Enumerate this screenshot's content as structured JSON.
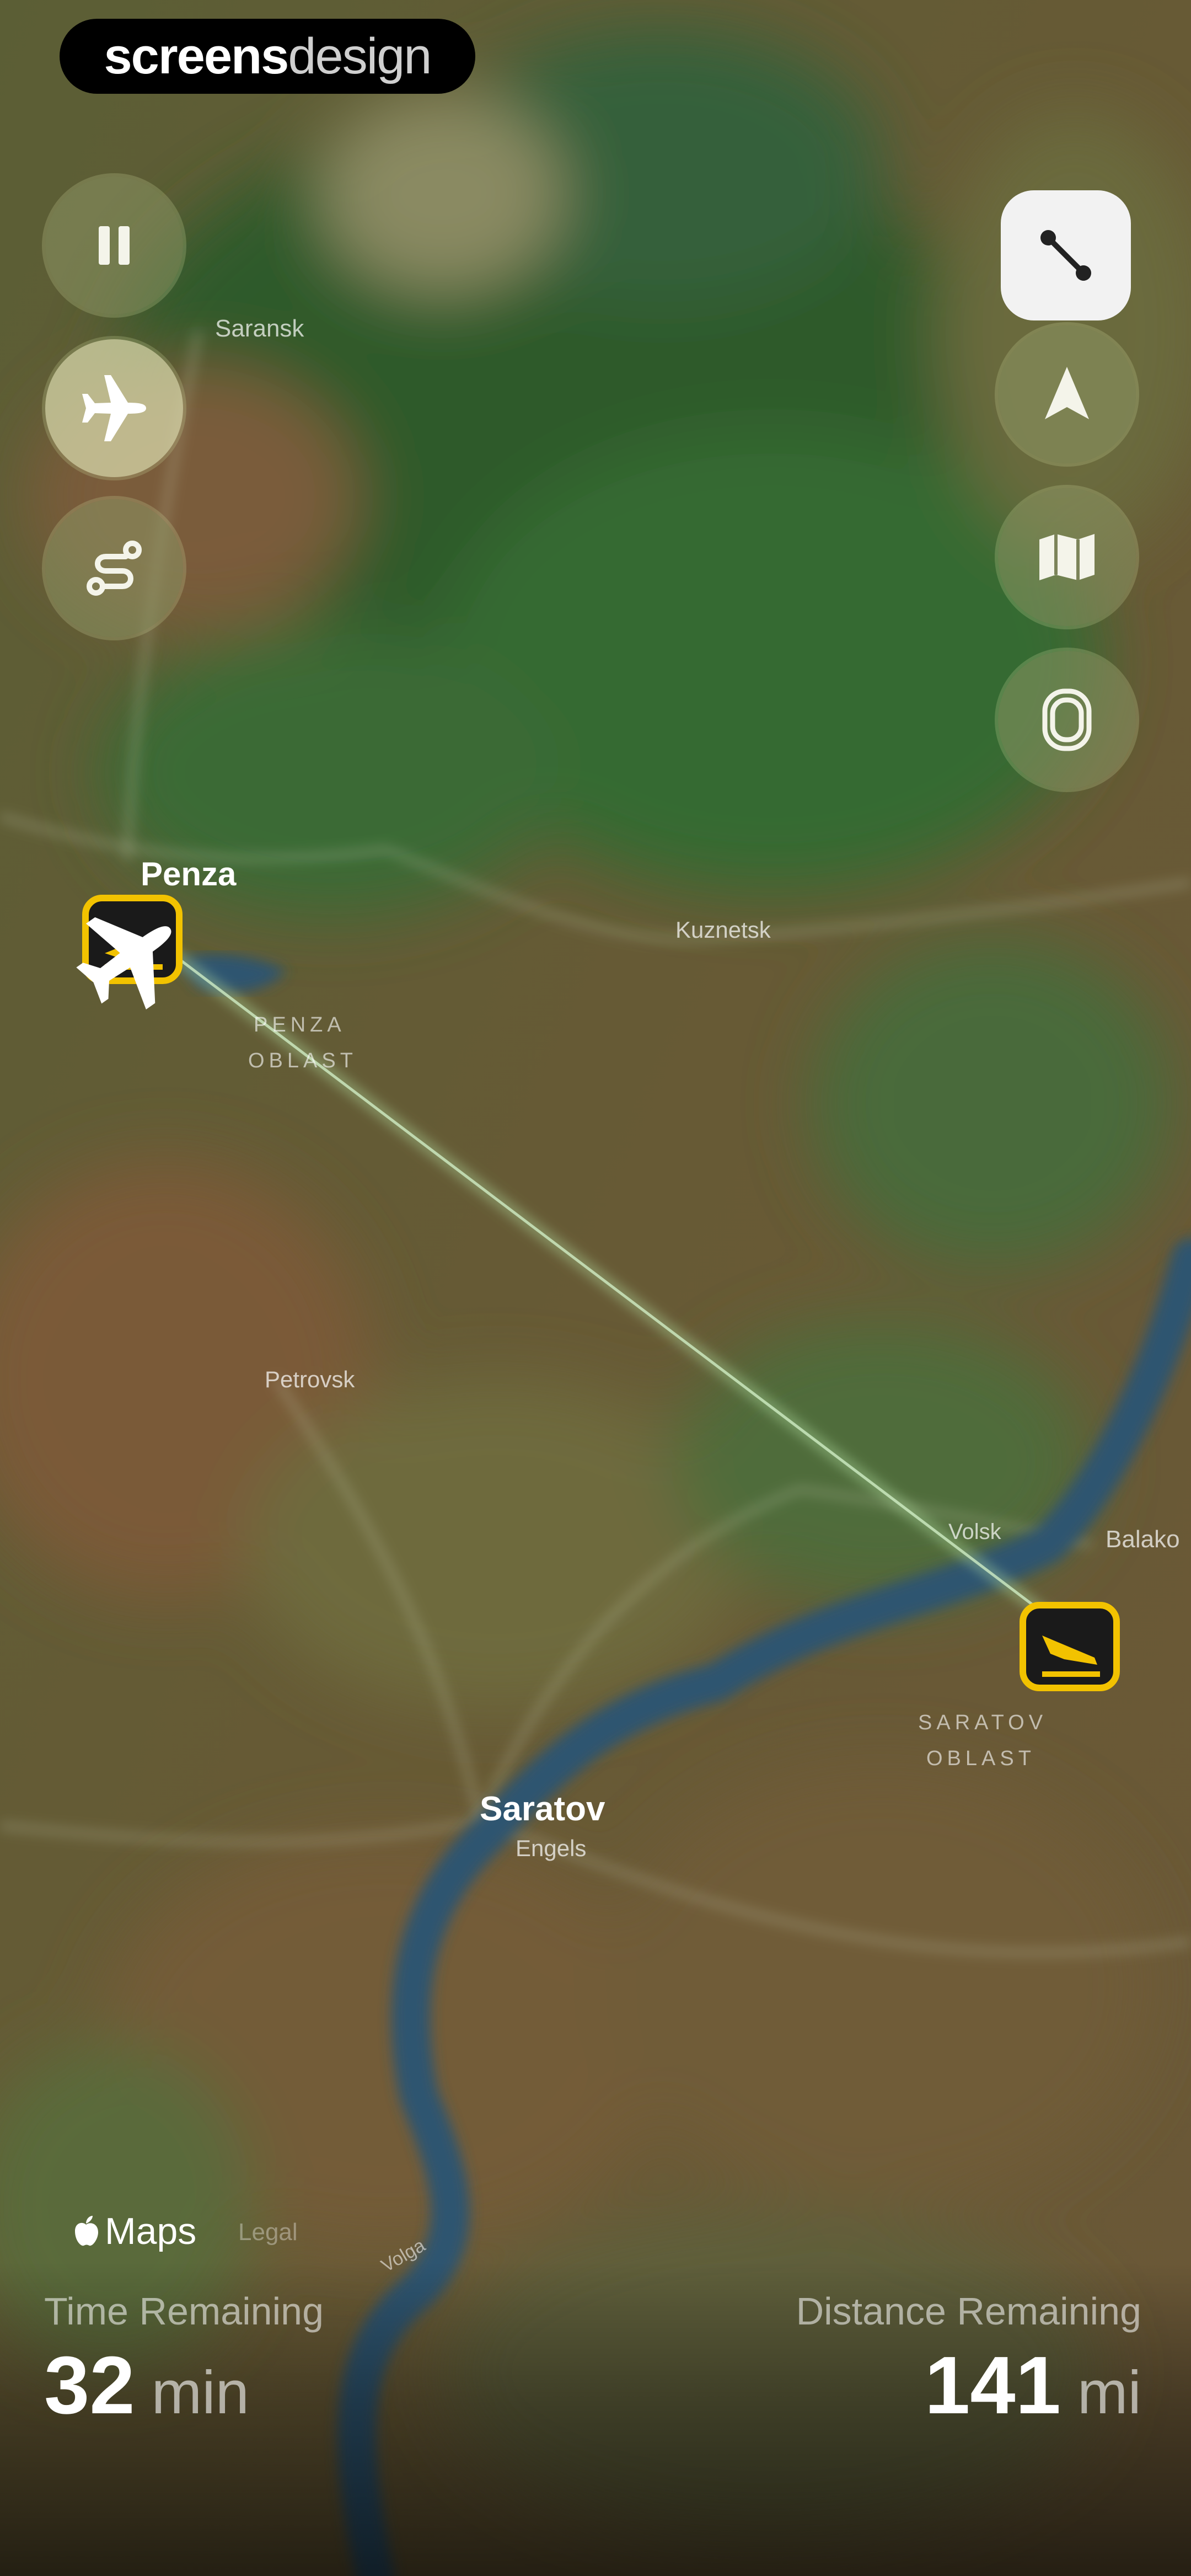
{
  "brand": {
    "part1": "screens",
    "part2": "design"
  },
  "map": {
    "cities": [
      {
        "name": "Saransk",
        "style": "small"
      },
      {
        "name": "Penza",
        "style": "major"
      },
      {
        "name": "Kuznetsk",
        "style": "small"
      },
      {
        "name": "Petrovsk",
        "style": "small"
      },
      {
        "name": "Saratov",
        "style": "major"
      },
      {
        "name": "Engels",
        "style": "small"
      },
      {
        "name": "Volsk",
        "style": "small"
      },
      {
        "name": "Balako",
        "style": "small"
      }
    ],
    "regions": [
      {
        "line1": "PENZA",
        "line2": "OBLAST"
      },
      {
        "line1": "SARATOV",
        "line2": "OBLAST"
      }
    ],
    "river": "Volga",
    "progress_fraction": 0.06
  },
  "controls": {
    "left": [
      {
        "icon": "pause-icon",
        "active": false
      },
      {
        "icon": "airplane-icon",
        "active": true
      },
      {
        "icon": "route-icon",
        "active": false
      }
    ],
    "right": [
      {
        "icon": "flight-path-icon",
        "style": "square"
      },
      {
        "icon": "navigation-arrow-icon",
        "style": "round"
      },
      {
        "icon": "map-icon",
        "style": "round"
      },
      {
        "icon": "airplane-window-icon",
        "style": "round"
      }
    ]
  },
  "attribution": {
    "maps": "Maps",
    "legal": "Legal"
  },
  "stats": {
    "time_label": "Time Remaining",
    "time_value": "32",
    "time_unit": "min",
    "distance_label": "Distance Remaining",
    "distance_value": "141",
    "distance_unit": "mi"
  },
  "colors": {
    "accent": "#f2c200",
    "water": "#2f5570",
    "route": "#b8e6a8"
  }
}
